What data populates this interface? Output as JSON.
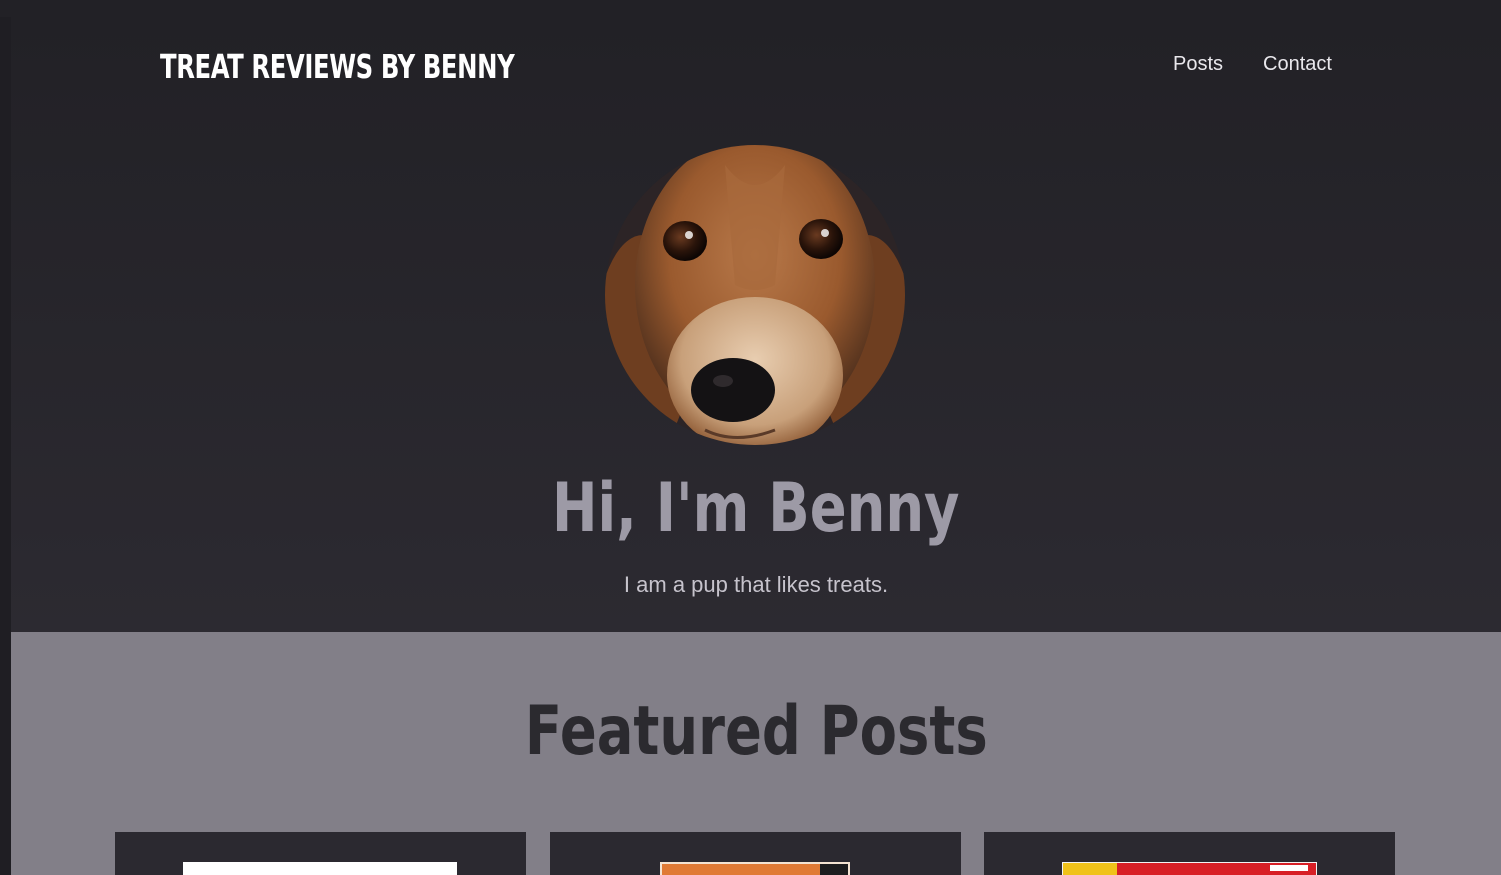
{
  "site": {
    "brand": "TREAT REVIEWS BY BENNY"
  },
  "nav": {
    "items": [
      {
        "label": "Posts"
      },
      {
        "label": "Contact"
      }
    ]
  },
  "hero": {
    "avatar_icon": "dog-portrait",
    "title": "Hi, I'm Benny",
    "subtitle": "I am a pup that likes treats."
  },
  "featured": {
    "title": "Featured Posts",
    "cards": [
      {
        "thumb_colors": [
          "#ffffff"
        ]
      },
      {
        "thumb_colors": [
          "#e07a35",
          "#1d1d1f"
        ]
      },
      {
        "thumb_colors": [
          "#f0c21a",
          "#d81f26",
          "#ffffff"
        ]
      }
    ]
  },
  "colors": {
    "page_bg": "#1f1e23",
    "hero_bg": "#252329",
    "hero_title": "#9d9aa6",
    "featured_bg": "#827f88",
    "card_bg": "#2b2930",
    "text_light": "#ffffff"
  }
}
